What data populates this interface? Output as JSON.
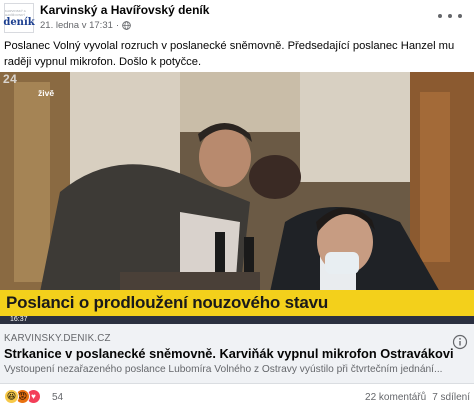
{
  "post": {
    "page_name": "Karvinský a Havířovský deník",
    "avatar_small_text": "Karvinský a Havířovský",
    "avatar_logo_text": "deník",
    "date": "21. ledna v 17:31",
    "separator": "·",
    "audience_icon": "globe-icon",
    "text": "Poslanec Volný vyvolal rozruch v poslanecké sněmovně. Předsedající poslanec Hanzel mu raději vypnul mikrofon. Došlo k potyčce."
  },
  "media": {
    "tv_logo": "24",
    "live_label": "živě",
    "headline": "Poslanci o prodloužení nouzového stavu",
    "ticker_time": "16:37"
  },
  "link_preview": {
    "domain": "KARVINSKY.DENIK.CZ",
    "title": "Strkanice v poslanecké sněmovně. Karviňák vypnul mikrofon Ostravákovi",
    "description": "Vystoupení nezařazeného poslance Lubomíra Volného z Ostravy vyústilo při čtvrtečním jednání..."
  },
  "engagement": {
    "reactions": [
      "haha",
      "angry",
      "love"
    ],
    "reaction_count": "54",
    "comments": "22 komentářů",
    "shares": "7 sdílení"
  },
  "colors": {
    "headline_bar": "#f3d01b",
    "link_bg": "#f0f2f5",
    "meta_text": "#65676b"
  }
}
